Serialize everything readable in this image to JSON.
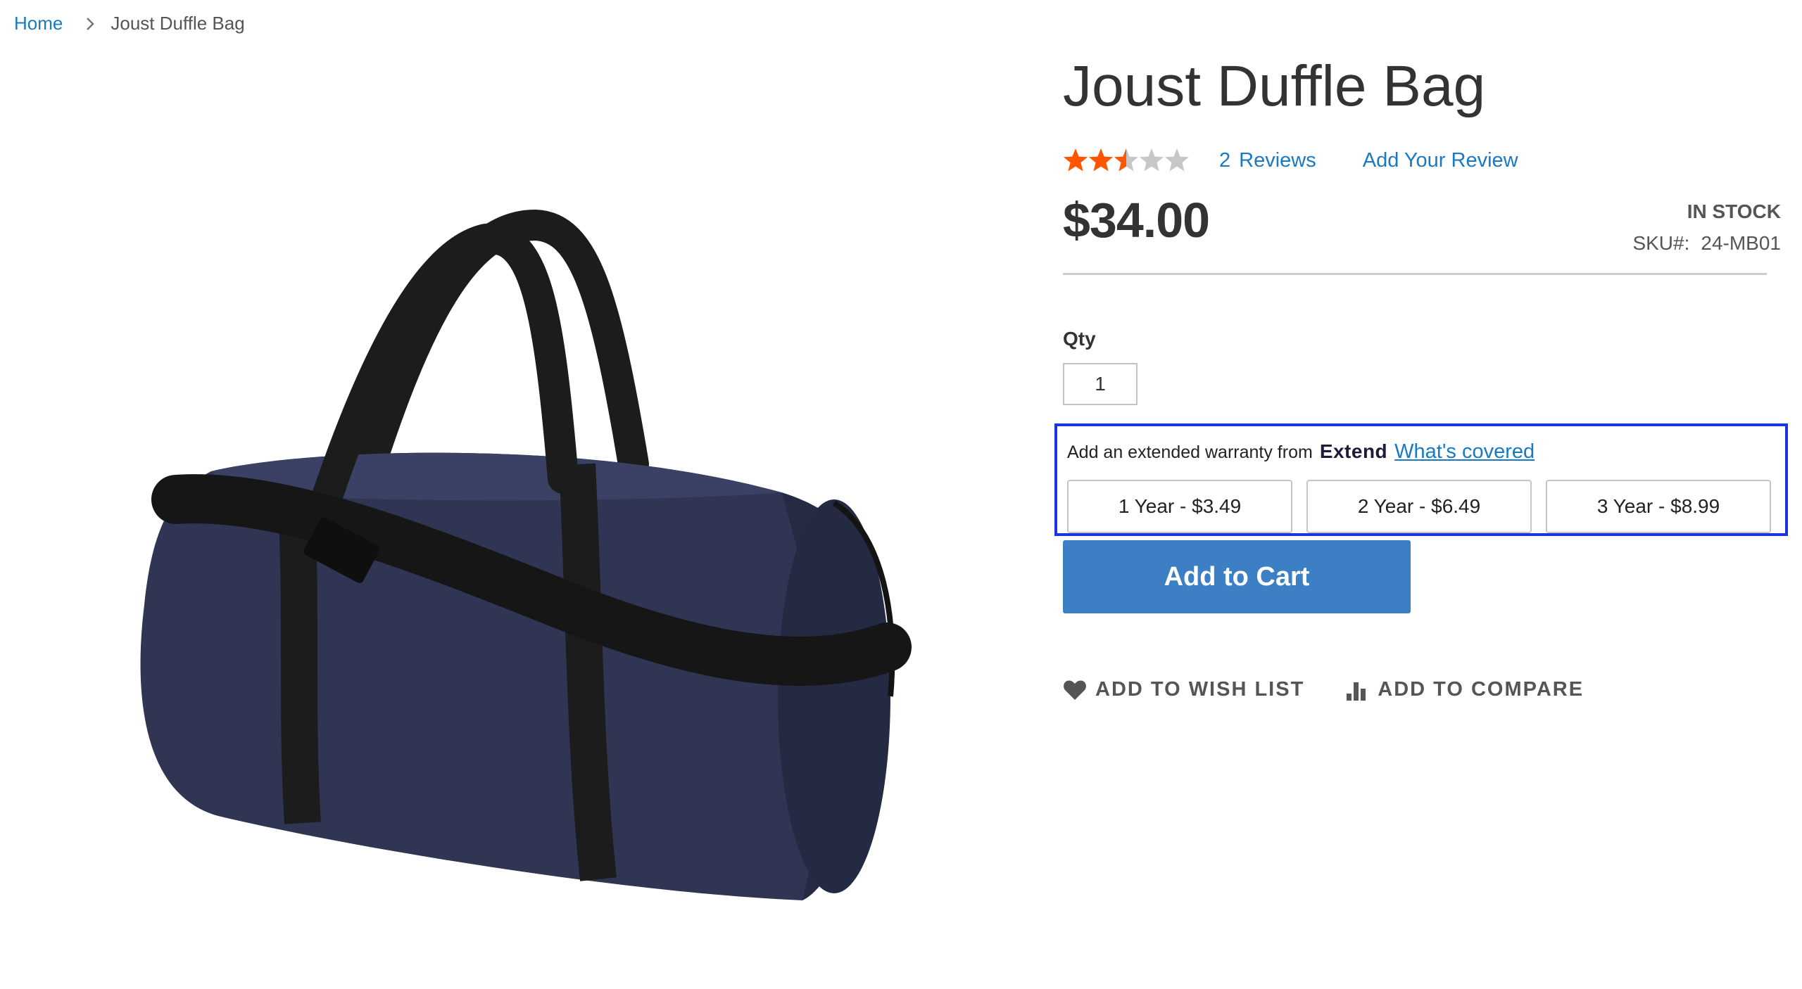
{
  "breadcrumb": {
    "home": "Home",
    "current": "Joust Duffle Bag"
  },
  "product": {
    "title": "Joust Duffle Bag",
    "rating": {
      "value": 2.5,
      "max": 5
    },
    "reviews_count": "2",
    "reviews_label": "Reviews",
    "add_review": "Add Your Review",
    "price": "$34.00",
    "stock": "IN STOCK",
    "sku_label": "SKU#:",
    "sku": "24-MB01",
    "image_alt": "Navy blue duffle bag with black straps"
  },
  "qty": {
    "label": "Qty",
    "value": "1"
  },
  "warranty": {
    "text": "Add an extended warranty from",
    "brand": "Extend",
    "link": "What's covered",
    "plans": [
      "1 Year - $3.49",
      "2 Year - $6.49",
      "3 Year - $8.99"
    ]
  },
  "cart": {
    "button": "Add to Cart"
  },
  "actions": {
    "wishlist": "ADD TO WISH LIST",
    "compare": "ADD TO COMPARE"
  },
  "colors": {
    "link": "#1979c3",
    "star_filled": "#ff5501",
    "star_empty": "#c7c7c7",
    "cart_button": "#3d7fc4",
    "warranty_border": "#1a35e0",
    "bag": "#2f3552",
    "strap": "#1c1c1c"
  }
}
